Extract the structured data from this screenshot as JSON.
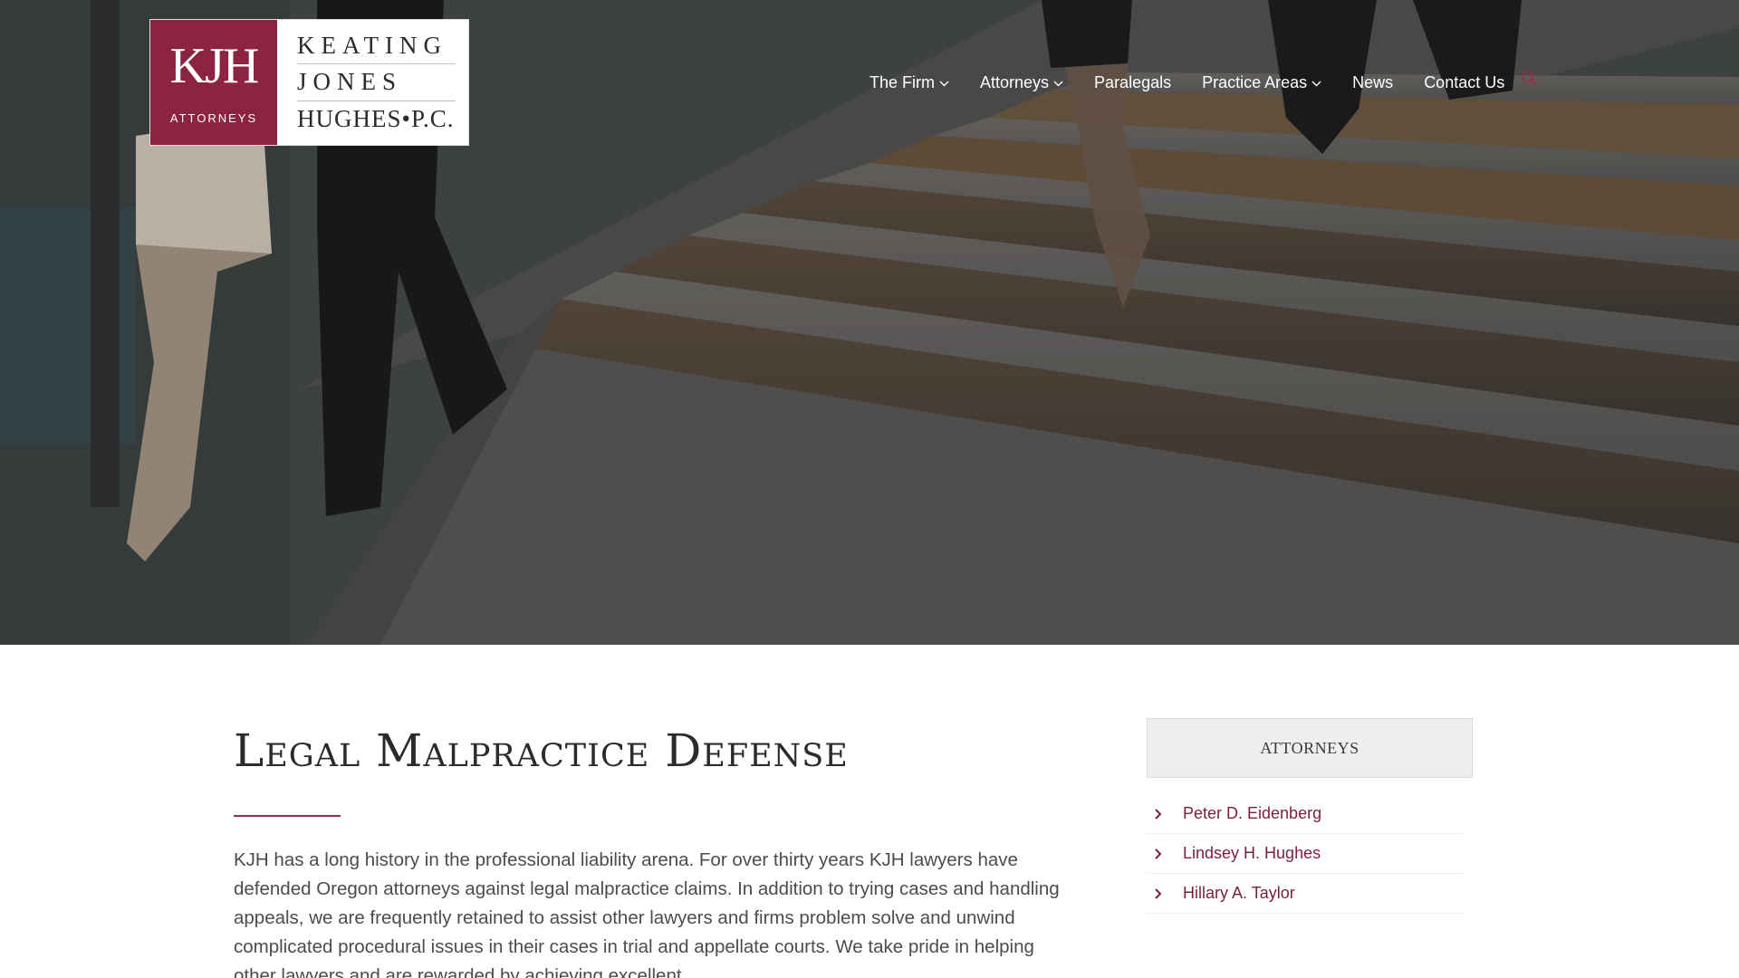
{
  "logo": {
    "mark": "KJH",
    "sub": "ATTORNEYS",
    "line1": "KEATING",
    "line2": "JONES",
    "line3": "HUGHES•P.C."
  },
  "nav": {
    "items": [
      {
        "label": "The Firm",
        "dropdown": true
      },
      {
        "label": "Attorneys",
        "dropdown": true
      },
      {
        "label": "Paralegals",
        "dropdown": false
      },
      {
        "label": "Practice Areas",
        "dropdown": true
      },
      {
        "label": "News",
        "dropdown": false
      },
      {
        "label": "Contact Us",
        "dropdown": false
      }
    ],
    "search_icon": "search-icon"
  },
  "main": {
    "title": "Legal Malpractice Defense",
    "body": "KJH has a long history in the professional liability arena.  For over thirty years KJH lawyers have defended Oregon attorneys against legal malpractice claims.  In addition to trying cases and handling appeals, we are frequently retained to assist other lawyers and firms problem solve and unwind complicated procedural issues in their cases in trial and appellate courts.  We take pride in helping other lawyers and are rewarded by achieving excellent"
  },
  "sidebar": {
    "heading": "ATTORNEYS",
    "attorneys": [
      {
        "name": "Peter D. Eidenberg"
      },
      {
        "name": "Lindsey H. Hughes"
      },
      {
        "name": "Hillary A. Taylor"
      }
    ]
  },
  "colors": {
    "brand": "#8c2342",
    "link": "#7a1f3a",
    "accent_rule": "#9a2d4a"
  }
}
